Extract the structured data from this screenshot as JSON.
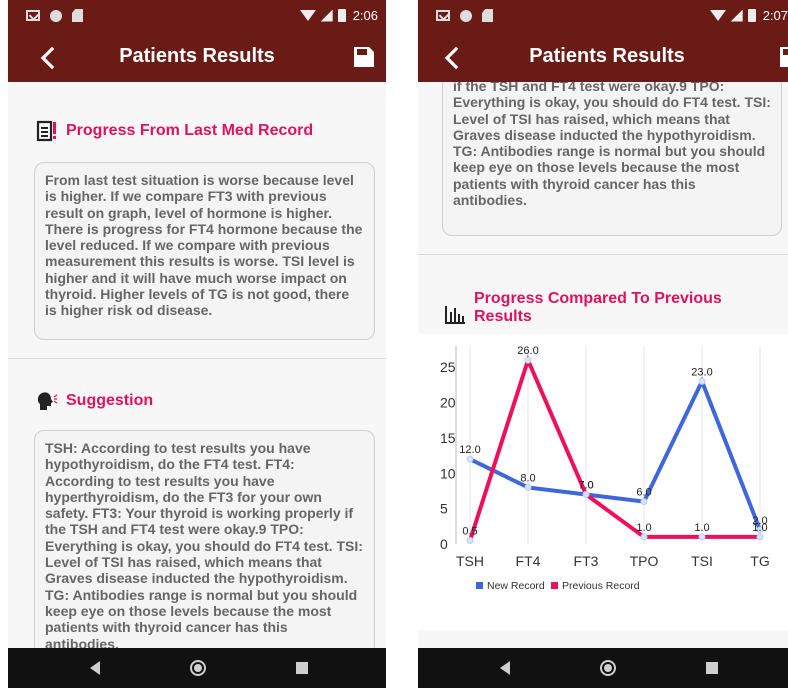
{
  "status_bar": {
    "left_time": "2:06",
    "right_time": "2:07"
  },
  "app_bar": {
    "title": "Patients Results"
  },
  "progress_section": {
    "title": "Progress From Last Med Record",
    "text": "From last test situation is worse because level is higher. If we compare FT3 with previous result on graph, level of hormone is higher. There is progress for FT4 hormone because the level reduced.  If we compare with previous measurement this results is worse.  TSI level is higher and it will have much worse impact on thyroid.  Higher levels of TG is not good, there is higher risk od disease."
  },
  "suggestion_section": {
    "title": "Suggestion",
    "text": "TSH: According to test results you have hypothyroidism, do the FT4 test. FT4: According to test results you have hyperthyroidism, do the FT3 for your own safety. FT3: Your thyroid is working properly if the TSH and FT4 test were okay.9 TPO: Everything is okay, you should do FT4 test. TSI: Level of TSI has raised, which means that Graves disease inducted the hypothyroidism. TG: Antibodies range is normal but you should keep eye on those levels because the most patients with thyroid cancer has this antibodies.",
    "visible_tail": "if the TSH and FT4 test were okay.9 TPO: Everything is okay, you should do FT4 test. TSI: Level of TSI has raised, which means that Graves disease inducted the hypothyroidism. TG: Antibodies range is normal but you should keep eye on those levels because the most patients with thyroid cancer has this antibodies."
  },
  "chart_section": {
    "title": "Progress Compared To Previous Results"
  },
  "icons": {
    "back": "back-arrow-icon",
    "save": "save-icon",
    "progress": "document-alert-icon",
    "suggestion": "speaking-head-icon",
    "chart": "bar-chart-icon"
  },
  "colors": {
    "app_bar": "#6a1b16",
    "accent": "#e0115f",
    "new_record": "#3f67dc",
    "previous_record": "#f0105a"
  },
  "chart_data": {
    "type": "line",
    "categories": [
      "TSH",
      "FT4",
      "FT3",
      "TPO",
      "TSI",
      "TG"
    ],
    "series": [
      {
        "name": "New Record",
        "values": [
          12.0,
          8.0,
          7.0,
          6.0,
          23.0,
          2.0
        ],
        "labels": [
          "12.0",
          "8.0",
          "7.0",
          "6.0",
          "23.0",
          "2.0"
        ]
      },
      {
        "name": "Previous Record",
        "values": [
          0.5,
          26.0,
          7.0,
          1.0,
          1.0,
          1.0
        ],
        "labels": [
          "0.5",
          "26.0",
          "7.0",
          "1.0",
          "1.0",
          "1.0"
        ]
      }
    ],
    "yticks": [
      "0",
      "5",
      "10",
      "15",
      "20",
      "25"
    ],
    "ylim": [
      0,
      28
    ],
    "legend_position": "bottom-left",
    "grid": "vertical"
  }
}
